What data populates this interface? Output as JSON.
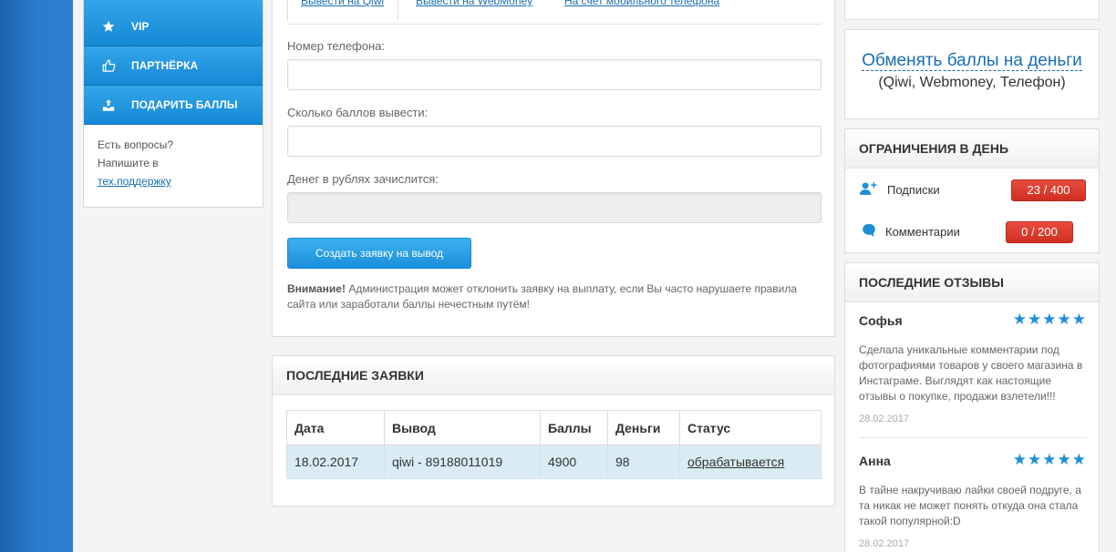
{
  "sidebar": {
    "items": [
      {
        "label": "VIP",
        "icon": "star-icon"
      },
      {
        "label": "ПАРТНЁРКА",
        "icon": "thumbs-up-icon"
      },
      {
        "label": "ПОДАРИТЬ БАЛЛЫ",
        "icon": "gift-upload-icon"
      }
    ],
    "help_line1": "Есть вопросы?",
    "help_line2": "Напишите в",
    "help_link": "тех.поддержку"
  },
  "withdraw": {
    "tabs": [
      "Вывести на Qiwi",
      "Вывести на WebMoney",
      "На счет мобильного телефона"
    ],
    "phone_label": "Номер телефона:",
    "phone_value": "",
    "points_label": "Сколько баллов вывести:",
    "points_value": "",
    "rub_label": "Денег в рублях зачислится:",
    "rub_value": "",
    "submit_label": "Создать заявку на вывод",
    "warning_bold": "Внимание!",
    "warning_text": " Администрация может отклонить заявку на выплату, если Вы часто нарушаете правила сайта или заработали баллы нечестным путём!"
  },
  "requests": {
    "title": "ПОСЛЕДНИЕ ЗАЯВКИ",
    "columns": [
      "Дата",
      "Вывод",
      "Баллы",
      "Деньги",
      "Статус"
    ],
    "rows": [
      {
        "date": "18.02.2017",
        "method": "qiwi - 89188011019",
        "points": "4900",
        "money": "98",
        "status": "обрабатывается"
      }
    ]
  },
  "exchange": {
    "title": "Обменять баллы на деньги",
    "subtitle": "(Qiwi, Webmoney, Телефон)"
  },
  "limits": {
    "title": "ОГРАНИЧЕНИЯ В ДЕНЬ",
    "items": [
      {
        "label": "Подписки",
        "value": "23 / 400",
        "icon": "add-user-icon"
      },
      {
        "label": "Комментарии",
        "value": "0 / 200",
        "icon": "comment-icon"
      }
    ],
    "badge_color": "#d8392b"
  },
  "reviews": {
    "title": "ПОСЛЕДНИЕ ОТЗЫВЫ",
    "items": [
      {
        "name": "Софья",
        "rating": 5,
        "text": "Сделала уникальные комментарии под фотографиями товаров у своего магазина в Инстаграме. Выглядят как настоящие отзывы о покупке, продажи взлетели!!!",
        "date": "28.02.2017"
      },
      {
        "name": "Анна",
        "rating": 5,
        "text": "В тайне накручиваю лайки своей подруге, а та никак не может понять откуда она стала такой популярной:D",
        "date": "28.02.2017"
      }
    ]
  },
  "colors": {
    "accent": "#1a8fdb",
    "link": "#1a6fb5",
    "background": "#2c7fd0"
  }
}
